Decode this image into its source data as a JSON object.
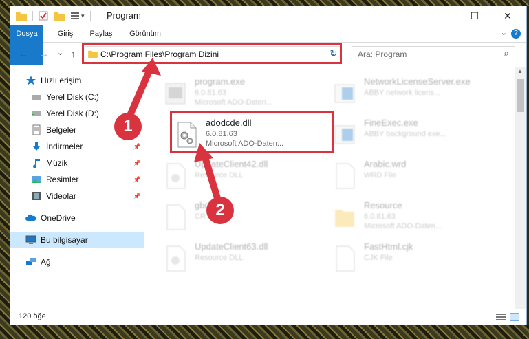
{
  "window": {
    "title": "Program",
    "minimize_label": "—",
    "maximize_label": "☐",
    "close_label": "✕"
  },
  "ribbon": {
    "tabs": [
      "Dosya",
      "Giriş",
      "Paylaş",
      "Görünüm"
    ],
    "help_label": "?"
  },
  "navigation": {
    "back_label": "←",
    "forward_label": "→",
    "recent_label": "⌄",
    "up_label": "↑",
    "address": "C:\\Program Files\\Program Dizini",
    "address_dropdown_label": "⌄",
    "refresh_label": "↻",
    "search_placeholder": "Ara: Program",
    "search_icon_label": "⌕"
  },
  "sidebar": {
    "items": [
      {
        "label": "Hızlı erişim",
        "icon": "star-icon"
      },
      {
        "label": "Yerel Disk (C:)",
        "icon": "drive-icon"
      },
      {
        "label": "Yerel Disk (D:)",
        "icon": "drive-icon"
      },
      {
        "label": "Belgeler",
        "icon": "document-icon"
      },
      {
        "label": "İndirmeler",
        "icon": "download-icon"
      },
      {
        "label": "Müzik",
        "icon": "music-icon"
      },
      {
        "label": "Resimler",
        "icon": "picture-icon"
      },
      {
        "label": "Videolar",
        "icon": "video-icon"
      },
      {
        "label": "OneDrive",
        "icon": "cloud-icon"
      },
      {
        "label": "Bu bilgisayar",
        "icon": "computer-icon"
      },
      {
        "label": "Ağ",
        "icon": "network-icon"
      }
    ],
    "pin_glyph": "📌"
  },
  "files": [
    {
      "name": "program.exe",
      "line1": "6.0.81.63",
      "line2": "Microsoft ADO-Daten..."
    },
    {
      "name": "NetworkLicenseServer.exe",
      "line1": "ABBY network licens...",
      "line2": ""
    },
    {
      "name": "adodcde.dll",
      "line1": "6.0.81.63",
      "line2": "Microsoft ADO-Daten..."
    },
    {
      "name": "FineExec.exe",
      "line1": "ABBY background exe...",
      "line2": ""
    },
    {
      "name": "UpdateClient42.dll",
      "line1": "Resource DLL",
      "line2": ""
    },
    {
      "name": "Arabic.wrd",
      "line1": "WRD File",
      "line2": ""
    },
    {
      "name": "gbd.dat",
      "line1": "CR File",
      "line2": ""
    },
    {
      "name": "Resource",
      "line1": "6.0.81.63",
      "line2": "Microsoft ADO-Daten..."
    },
    {
      "name": "UpdateClient63.dll",
      "line1": "Resource DLL",
      "line2": ""
    },
    {
      "name": "FastHtml.cjk",
      "line1": "CJK File",
      "line2": ""
    }
  ],
  "status": {
    "item_count": "120 öğe"
  },
  "callouts": [
    "1",
    "2"
  ],
  "colors": {
    "accent": "#1979ca",
    "highlight": "#d9333f",
    "selection": "#cce8ff"
  }
}
